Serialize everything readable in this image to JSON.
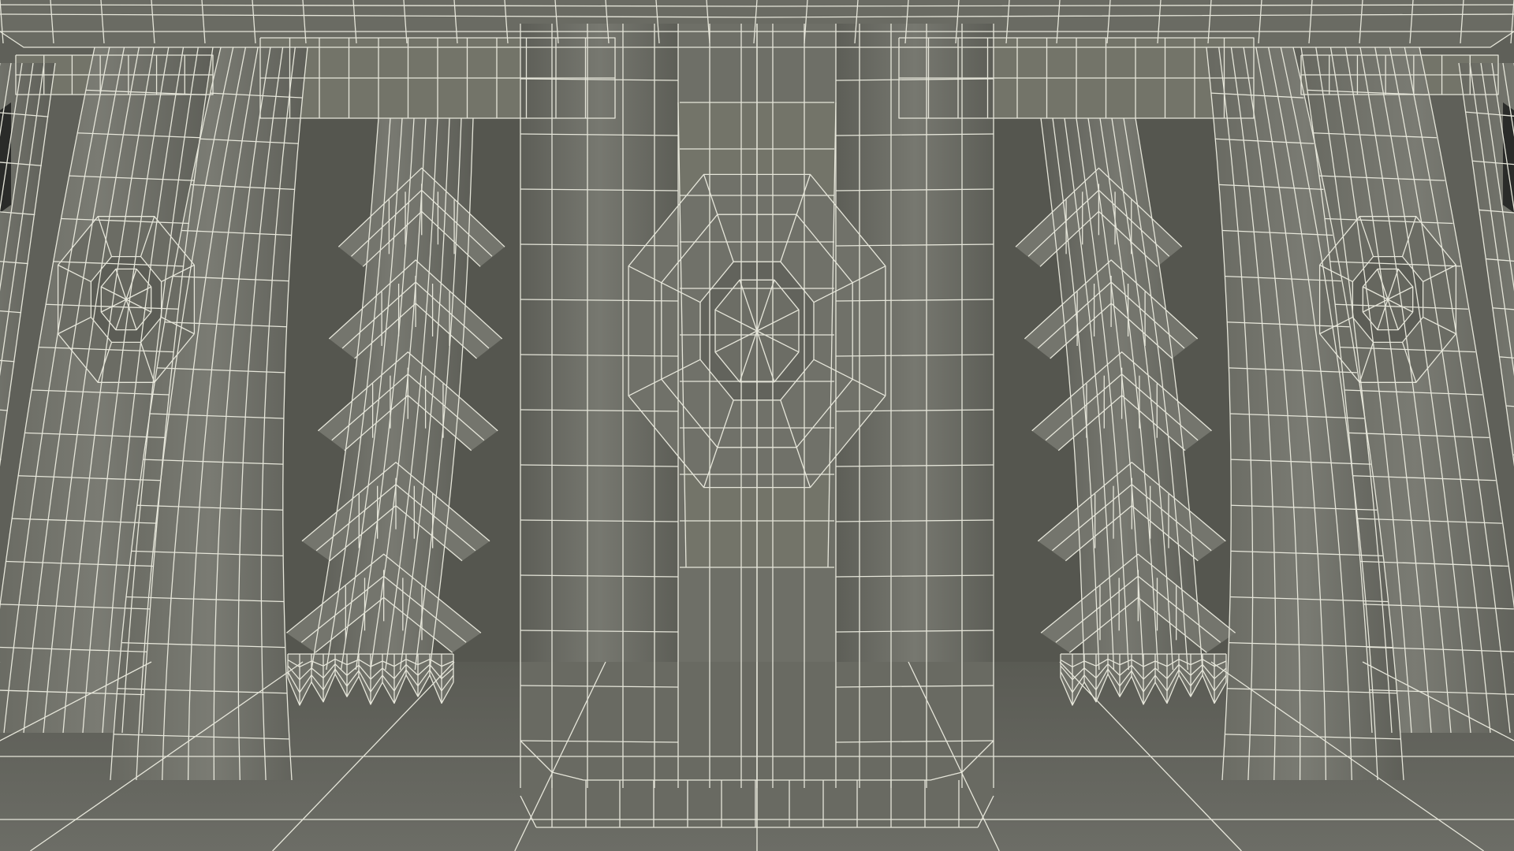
{
  "scene": {
    "description_free": true,
    "colors": {
      "background": "#4b4c46",
      "surface": "#6f7068",
      "surface_light": "#7c7d75",
      "surface_dark": "#55564f",
      "shadow": "#3c3d38",
      "wire": "#e6e6da",
      "void": "#2a2b29"
    },
    "style": "wireframe-on-shaded"
  }
}
